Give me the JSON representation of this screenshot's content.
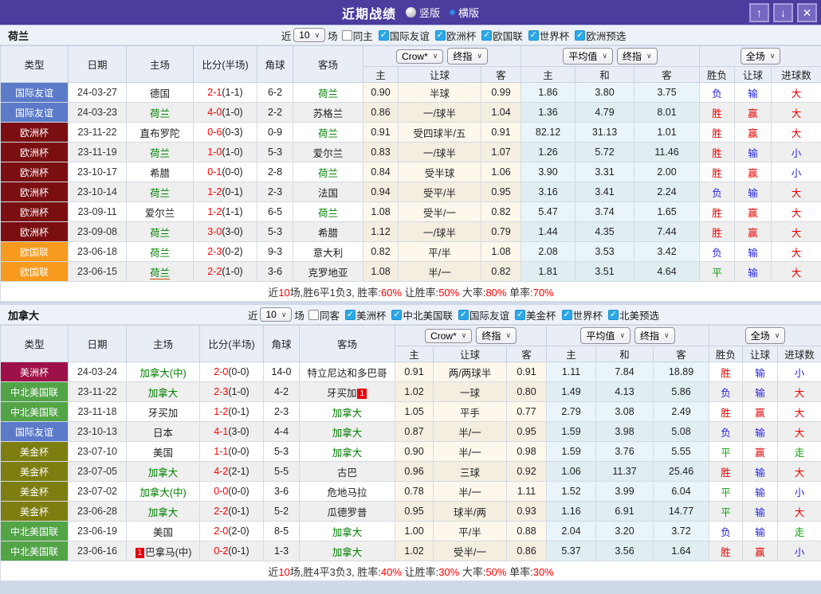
{
  "titlebar": {
    "title": "近期战绩",
    "radio_vertical": "竖版",
    "radio_horizontal": "横版",
    "buttons": {
      "up": "↑",
      "down": "↓",
      "close": "✕"
    }
  },
  "controls": {
    "near_label": "近",
    "count": "10",
    "games_label": "场",
    "odds_source": "Crow*",
    "odds_stage": "终指",
    "avg_source": "平均值",
    "avg_stage": "终指",
    "scope": "全场"
  },
  "table_header": {
    "cols": [
      "类型",
      "日期",
      "主场",
      "比分(半场)",
      "角球",
      "客场"
    ],
    "odds_cols": [
      "主",
      "让球",
      "客"
    ],
    "avg_cols": [
      "主",
      "和",
      "客"
    ],
    "result_cols": [
      "胜负",
      "让球",
      "进球数"
    ]
  },
  "league_colors": {
    "国际友谊": "#5b7ac8",
    "欧洲杯": "#7a0e10",
    "欧国联": "#f79a1e",
    "美洲杯": "#9e1148",
    "中北美国联": "#52a447",
    "美金杯": "#7e7e10"
  },
  "colors": {
    "titlebar": "#4a3d9e",
    "check": "#2aa9e9",
    "red": "#e60000",
    "blue": "#2424e0",
    "green": "#0b9b0b",
    "teamgreen": "#008000",
    "scorered": "#ff0000"
  },
  "sections": [
    {
      "team": "荷兰",
      "same_label": "同主",
      "same_checked": false,
      "leagues": [
        "国际友谊",
        "欧洲杯",
        "欧国联",
        "世界杯",
        "欧洲预选"
      ],
      "rows": [
        {
          "lg": "国际友谊",
          "date": "24-03-27",
          "home": {
            "t": "德国"
          },
          "sc": "2-1",
          "hf": "(1-1)",
          "cn": "6-2",
          "away": {
            "t": "荷兰",
            "g": 1
          },
          "o1": "0.90",
          "h": "半球",
          "o2": "0.99",
          "a1": "1.86",
          "a2": "3.80",
          "a3": "3.75",
          "r": [
            "负",
            "b"
          ],
          "hr": [
            "输",
            "b"
          ],
          "gr": [
            "大",
            "r"
          ]
        },
        {
          "lg": "国际友谊",
          "date": "24-03-23",
          "home": {
            "t": "荷兰",
            "g": 1
          },
          "sc": "4-0",
          "hf": "(1-0)",
          "cn": "2-2",
          "away": {
            "t": "苏格兰"
          },
          "o1": "0.86",
          "h": "一/球半",
          "o2": "1.04",
          "a1": "1.36",
          "a2": "4.79",
          "a3": "8.01",
          "r": [
            "胜",
            "r"
          ],
          "hr": [
            "赢",
            "r"
          ],
          "gr": [
            "大",
            "r"
          ]
        },
        {
          "lg": "欧洲杯",
          "date": "23-11-22",
          "home": {
            "t": "直布罗陀"
          },
          "sc": "0-6",
          "hf": "(0-3)",
          "cn": "0-9",
          "away": {
            "t": "荷兰",
            "g": 1
          },
          "o1": "0.91",
          "h": "受四球半/五",
          "o2": "0.91",
          "a1": "82.12",
          "a2": "31.13",
          "a3": "1.01",
          "r": [
            "胜",
            "r"
          ],
          "hr": [
            "赢",
            "r"
          ],
          "gr": [
            "大",
            "r"
          ]
        },
        {
          "lg": "欧洲杯",
          "date": "23-11-19",
          "home": {
            "t": "荷兰",
            "g": 1
          },
          "sc": "1-0",
          "hf": "(1-0)",
          "cn": "5-3",
          "away": {
            "t": "爱尔兰"
          },
          "o1": "0.83",
          "h": "一/球半",
          "o2": "1.07",
          "a1": "1.26",
          "a2": "5.72",
          "a3": "11.46",
          "r": [
            "胜",
            "r"
          ],
          "hr": [
            "输",
            "b"
          ],
          "gr": [
            "小",
            "b"
          ]
        },
        {
          "lg": "欧洲杯",
          "date": "23-10-17",
          "home": {
            "t": "希腊"
          },
          "sc": "0-1",
          "hf": "(0-0)",
          "cn": "2-8",
          "away": {
            "t": "荷兰",
            "g": 1
          },
          "o1": "0.84",
          "h": "受半球",
          "o2": "1.06",
          "a1": "3.90",
          "a2": "3.31",
          "a3": "2.00",
          "r": [
            "胜",
            "r"
          ],
          "hr": [
            "赢",
            "r"
          ],
          "gr": [
            "小",
            "b"
          ]
        },
        {
          "lg": "欧洲杯",
          "date": "23-10-14",
          "home": {
            "t": "荷兰",
            "g": 1
          },
          "sc": "1-2",
          "hf": "(0-1)",
          "cn": "2-3",
          "away": {
            "t": "法国"
          },
          "o1": "0.94",
          "h": "受平/半",
          "o2": "0.95",
          "a1": "3.16",
          "a2": "3.41",
          "a3": "2.24",
          "r": [
            "负",
            "b"
          ],
          "hr": [
            "输",
            "b"
          ],
          "gr": [
            "大",
            "r"
          ]
        },
        {
          "lg": "欧洲杯",
          "date": "23-09-11",
          "home": {
            "t": "爱尔兰"
          },
          "sc": "1-2",
          "hf": "(1-1)",
          "cn": "6-5",
          "away": {
            "t": "荷兰",
            "g": 1
          },
          "o1": "1.08",
          "h": "受半/一",
          "o2": "0.82",
          "a1": "5.47",
          "a2": "3.74",
          "a3": "1.65",
          "r": [
            "胜",
            "r"
          ],
          "hr": [
            "赢",
            "r"
          ],
          "gr": [
            "大",
            "r"
          ]
        },
        {
          "lg": "欧洲杯",
          "date": "23-09-08",
          "home": {
            "t": "荷兰",
            "g": 1
          },
          "sc": "3-0",
          "hf": "(3-0)",
          "cn": "5-3",
          "away": {
            "t": "希腊"
          },
          "o1": "1.12",
          "h": "一/球半",
          "o2": "0.79",
          "a1": "1.44",
          "a2": "4.35",
          "a3": "7.44",
          "r": [
            "胜",
            "r"
          ],
          "hr": [
            "赢",
            "r"
          ],
          "gr": [
            "大",
            "r"
          ]
        },
        {
          "lg": "欧国联",
          "date": "23-06-18",
          "home": {
            "t": "荷兰",
            "g": 1
          },
          "sc": "2-3",
          "hf": "(0-2)",
          "cn": "9-3",
          "away": {
            "t": "意大利"
          },
          "o1": "0.82",
          "h": "平/半",
          "o2": "1.08",
          "a1": "2.08",
          "a2": "3.53",
          "a3": "3.42",
          "r": [
            "负",
            "b"
          ],
          "hr": [
            "输",
            "b"
          ],
          "gr": [
            "大",
            "r"
          ]
        },
        {
          "lg": "欧国联",
          "date": "23-06-15",
          "home": {
            "t": "荷兰",
            "g": 1,
            "u": 1
          },
          "sc": "2-2",
          "hf": "(1-0)",
          "cn": "3-6",
          "away": {
            "t": "克罗地亚"
          },
          "o1": "1.08",
          "h": "半/一",
          "o2": "0.82",
          "a1": "1.81",
          "a2": "3.51",
          "a3": "4.64",
          "r": [
            "平",
            "g"
          ],
          "hr": [
            "输",
            "b"
          ],
          "gr": [
            "大",
            "r"
          ]
        }
      ],
      "summary": [
        [
          "近",
          "k"
        ],
        [
          "10",
          "r"
        ],
        [
          "场,胜6平1负3, 胜率:",
          "k"
        ],
        [
          "60%",
          "r"
        ],
        [
          " 让胜率:",
          "k"
        ],
        [
          "50%",
          "r"
        ],
        [
          " 大率:",
          "k"
        ],
        [
          "80%",
          "r"
        ],
        [
          " 单率:",
          "k"
        ],
        [
          "70%",
          "r"
        ]
      ]
    },
    {
      "team": "加拿大",
      "same_label": "同客",
      "same_checked": false,
      "leagues": [
        "美洲杯",
        "中北美国联",
        "国际友谊",
        "美金杯",
        "世界杯",
        "北美预选"
      ],
      "rows": [
        {
          "lg": "美洲杯",
          "date": "24-03-24",
          "home": {
            "t": "加拿大(中)",
            "g": 1
          },
          "sc": "2-0",
          "hf": "(0-0)",
          "cn": "14-0",
          "away": {
            "t": "特立尼达和多巴哥"
          },
          "o1": "0.91",
          "h": "两/两球半",
          "o2": "0.91",
          "a1": "1.11",
          "a2": "7.84",
          "a3": "18.89",
          "r": [
            "胜",
            "r"
          ],
          "hr": [
            "输",
            "b"
          ],
          "gr": [
            "小",
            "b"
          ]
        },
        {
          "lg": "中北美国联",
          "date": "23-11-22",
          "home": {
            "t": "加拿大",
            "g": 1
          },
          "sc": "2-3",
          "hf": "(1-0)",
          "cn": "4-2",
          "away": {
            "t": "牙买加",
            "mark": "1",
            "markpos": "after"
          },
          "o1": "1.02",
          "h": "一球",
          "o2": "0.80",
          "a1": "1.49",
          "a2": "4.13",
          "a3": "5.86",
          "r": [
            "负",
            "b"
          ],
          "hr": [
            "输",
            "b"
          ],
          "gr": [
            "大",
            "r"
          ]
        },
        {
          "lg": "中北美国联",
          "date": "23-11-18",
          "home": {
            "t": "牙买加"
          },
          "sc": "1-2",
          "hf": "(0-1)",
          "cn": "2-3",
          "away": {
            "t": "加拿大",
            "g": 1
          },
          "o1": "1.05",
          "h": "平手",
          "o2": "0.77",
          "a1": "2.79",
          "a2": "3.08",
          "a3": "2.49",
          "r": [
            "胜",
            "r"
          ],
          "hr": [
            "赢",
            "r"
          ],
          "gr": [
            "大",
            "r"
          ]
        },
        {
          "lg": "国际友谊",
          "date": "23-10-13",
          "home": {
            "t": "日本"
          },
          "sc": "4-1",
          "hf": "(3-0)",
          "cn": "4-4",
          "away": {
            "t": "加拿大",
            "g": 1
          },
          "o1": "0.87",
          "h": "半/一",
          "o2": "0.95",
          "a1": "1.59",
          "a2": "3.98",
          "a3": "5.08",
          "r": [
            "负",
            "b"
          ],
          "hr": [
            "输",
            "b"
          ],
          "gr": [
            "大",
            "r"
          ]
        },
        {
          "lg": "美金杯",
          "date": "23-07-10",
          "home": {
            "t": "美国"
          },
          "sc": "1-1",
          "hf": "(0-0)",
          "cn": "5-3",
          "away": {
            "t": "加拿大",
            "g": 1
          },
          "o1": "0.90",
          "h": "半/一",
          "o2": "0.98",
          "a1": "1.59",
          "a2": "3.76",
          "a3": "5.55",
          "r": [
            "平",
            "g"
          ],
          "hr": [
            "赢",
            "r"
          ],
          "gr": [
            "走",
            "g"
          ]
        },
        {
          "lg": "美金杯",
          "date": "23-07-05",
          "home": {
            "t": "加拿大",
            "g": 1
          },
          "sc": "4-2",
          "hf": "(2-1)",
          "cn": "5-5",
          "away": {
            "t": "古巴"
          },
          "o1": "0.96",
          "h": "三球",
          "o2": "0.92",
          "a1": "1.06",
          "a2": "11.37",
          "a3": "25.46",
          "r": [
            "胜",
            "r"
          ],
          "hr": [
            "输",
            "b"
          ],
          "gr": [
            "大",
            "r"
          ]
        },
        {
          "lg": "美金杯",
          "date": "23-07-02",
          "home": {
            "t": "加拿大(中)",
            "g": 1
          },
          "sc": "0-0",
          "hf": "(0-0)",
          "cn": "3-6",
          "away": {
            "t": "危地马拉"
          },
          "o1": "0.78",
          "h": "半/一",
          "o2": "1.11",
          "a1": "1.52",
          "a2": "3.99",
          "a3": "6.04",
          "r": [
            "平",
            "g"
          ],
          "hr": [
            "输",
            "b"
          ],
          "gr": [
            "小",
            "b"
          ]
        },
        {
          "lg": "美金杯",
          "date": "23-06-28",
          "home": {
            "t": "加拿大",
            "g": 1
          },
          "sc": "2-2",
          "hf": "(0-1)",
          "cn": "5-2",
          "away": {
            "t": "瓜德罗普"
          },
          "o1": "0.95",
          "h": "球半/两",
          "o2": "0.93",
          "a1": "1.16",
          "a2": "6.91",
          "a3": "14.77",
          "r": [
            "平",
            "g"
          ],
          "hr": [
            "输",
            "b"
          ],
          "gr": [
            "大",
            "r"
          ]
        },
        {
          "lg": "中北美国联",
          "date": "23-06-19",
          "home": {
            "t": "美国"
          },
          "sc": "2-0",
          "hf": "(2-0)",
          "cn": "8-5",
          "away": {
            "t": "加拿大",
            "g": 1
          },
          "o1": "1.00",
          "h": "平/半",
          "o2": "0.88",
          "a1": "2.04",
          "a2": "3.20",
          "a3": "3.72",
          "r": [
            "负",
            "b"
          ],
          "hr": [
            "输",
            "b"
          ],
          "gr": [
            "走",
            "g"
          ]
        },
        {
          "lg": "中北美国联",
          "date": "23-06-16",
          "home": {
            "t": "巴拿马(中)",
            "mark": "1",
            "markpos": "before"
          },
          "sc": "0-2",
          "hf": "(0-1)",
          "cn": "1-3",
          "away": {
            "t": "加拿大",
            "g": 1
          },
          "o1": "1.02",
          "h": "受半/一",
          "o2": "0.86",
          "a1": "5.37",
          "a2": "3.56",
          "a3": "1.64",
          "r": [
            "胜",
            "r"
          ],
          "hr": [
            "赢",
            "r"
          ],
          "gr": [
            "小",
            "b"
          ]
        }
      ],
      "summary": [
        [
          "近",
          "k"
        ],
        [
          "10",
          "r"
        ],
        [
          "场,胜4平3负3, 胜率:",
          "k"
        ],
        [
          "40%",
          "r"
        ],
        [
          " 让胜率:",
          "k"
        ],
        [
          "30%",
          "r"
        ],
        [
          " 大率:",
          "k"
        ],
        [
          "50%",
          "r"
        ],
        [
          " 单率:",
          "k"
        ],
        [
          "30%",
          "r"
        ]
      ]
    }
  ]
}
